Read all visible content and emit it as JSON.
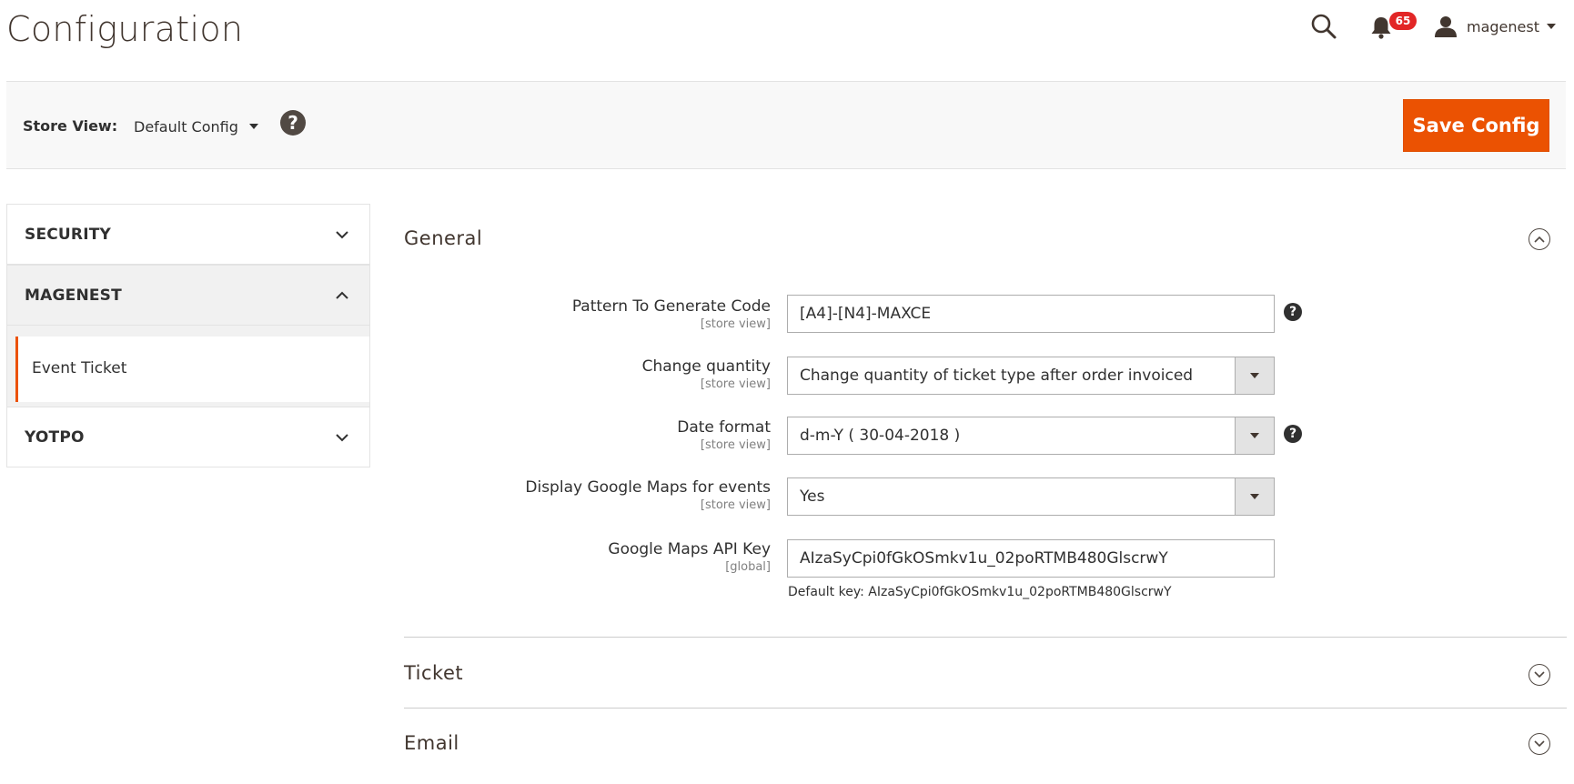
{
  "header": {
    "title": "Configuration",
    "notifications_count": "65",
    "username": "magenest"
  },
  "store_bar": {
    "label": "Store View:",
    "selected": "Default Config",
    "help": "?",
    "save_label": "Save Config"
  },
  "sidebar": {
    "sections": [
      {
        "label": "SECURITY",
        "expanded": false
      },
      {
        "label": "MAGENEST",
        "expanded": true,
        "items": [
          {
            "label": "Event Ticket",
            "active": true
          }
        ]
      },
      {
        "label": "YOTPO",
        "expanded": false
      }
    ]
  },
  "main": {
    "sections": [
      {
        "title": "General",
        "expanded": true
      },
      {
        "title": "Ticket",
        "expanded": false
      },
      {
        "title": "Email",
        "expanded": false
      }
    ],
    "fields": [
      {
        "label": "Pattern To Generate Code",
        "scope": "[store view]",
        "value": "[A4]-[N4]-MAXCE",
        "has_help": true
      },
      {
        "label": "Change quantity",
        "scope": "[store view]",
        "value": "Change quantity of ticket type after order invoiced",
        "has_help": false
      },
      {
        "label": "Date format",
        "scope": "[store view]",
        "value": "d-m-Y ( 30-04-2018 )",
        "has_help": true
      },
      {
        "label": "Display Google Maps for events",
        "scope": "[store view]",
        "value": "Yes",
        "has_help": false
      },
      {
        "label": "Google Maps API Key",
        "scope": "[global]",
        "value": "AIzaSyCpi0fGkOSmkv1u_02poRTMB480GlscrwY",
        "has_help": false,
        "note": "Default key: AIzaSyCpi0fGkOSmkv1u_02poRTMB480GlscrwY"
      }
    ],
    "help_glyph": "?"
  },
  "colors": {
    "accent": "#eb5202",
    "badge": "#e22626",
    "text_dark": "#303030",
    "title_brown": "#41362f"
  }
}
